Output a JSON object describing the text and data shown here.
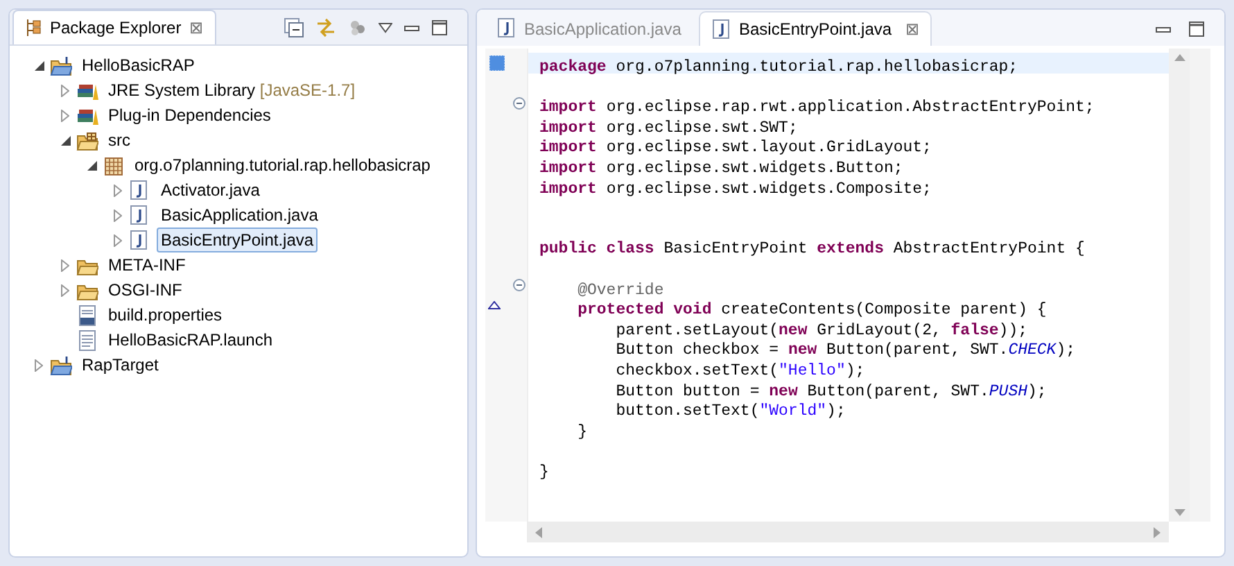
{
  "explorer": {
    "tab": {
      "label": "Package Explorer",
      "selected": true,
      "close": "⊠"
    },
    "tree": [
      {
        "label": "HelloBasicRAP",
        "kind": "project",
        "expanded": true,
        "selected": false,
        "children": [
          {
            "label": "JRE System Library",
            "suffix": "[JavaSE-1.7]",
            "kind": "library",
            "expanded": false,
            "selected": false
          },
          {
            "label": "Plug-in Dependencies",
            "kind": "library",
            "expanded": false,
            "selected": false
          },
          {
            "label": "src",
            "kind": "source-folder",
            "expanded": true,
            "selected": false,
            "children": [
              {
                "label": "org.o7planning.tutorial.rap.hellobasicrap",
                "kind": "package",
                "expanded": true,
                "selected": false,
                "children": [
                  {
                    "label": "Activator.java",
                    "kind": "java-file",
                    "expanded": false,
                    "selected": false
                  },
                  {
                    "label": "BasicApplication.java",
                    "kind": "java-file",
                    "expanded": false,
                    "selected": false
                  },
                  {
                    "label": "BasicEntryPoint.java",
                    "kind": "java-file",
                    "expanded": false,
                    "selected": true
                  }
                ]
              }
            ]
          },
          {
            "label": "META-INF",
            "kind": "folder",
            "expanded": false,
            "selected": false
          },
          {
            "label": "OSGI-INF",
            "kind": "folder",
            "expanded": false,
            "selected": false
          },
          {
            "label": "build.properties",
            "kind": "binary-file",
            "selected": false
          },
          {
            "label": "HelloBasicRAP.launch",
            "kind": "text-file",
            "selected": false
          }
        ]
      },
      {
        "label": "RapTarget",
        "kind": "project",
        "expanded": false,
        "selected": false
      }
    ]
  },
  "editor": {
    "tabs": [
      {
        "label": "BasicApplication.java",
        "selected": false
      },
      {
        "label": "BasicEntryPoint.java",
        "selected": true,
        "close": "⊠"
      }
    ],
    "lines": [
      {
        "current": true,
        "kind": "bookmark",
        "tokens": [
          {
            "kind": "keyword",
            "text": "package"
          },
          {
            "kind": "plain",
            "text": " org.o7planning.tutorial.rap.hellobasicrap;"
          }
        ]
      },
      {
        "current": false
      },
      {
        "current": false,
        "kind": "fold",
        "tokens": [
          {
            "kind": "keyword",
            "text": "import"
          },
          {
            "kind": "plain",
            "text": " org.eclipse.rap.rwt.application.AbstractEntryPoint;"
          }
        ]
      },
      {
        "current": false,
        "tokens": [
          {
            "kind": "keyword",
            "text": "import"
          },
          {
            "kind": "plain",
            "text": " org.eclipse.swt.SWT;"
          }
        ]
      },
      {
        "current": false,
        "tokens": [
          {
            "kind": "keyword",
            "text": "import"
          },
          {
            "kind": "plain",
            "text": " org.eclipse.swt.layout.GridLayout;"
          }
        ]
      },
      {
        "current": false,
        "tokens": [
          {
            "kind": "keyword",
            "text": "import"
          },
          {
            "kind": "plain",
            "text": " org.eclipse.swt.widgets.Button;"
          }
        ]
      },
      {
        "current": false,
        "tokens": [
          {
            "kind": "keyword",
            "text": "import"
          },
          {
            "kind": "plain",
            "text": " org.eclipse.swt.widgets.Composite;"
          }
        ]
      },
      {
        "current": false
      },
      {
        "current": false
      },
      {
        "current": false,
        "tokens": [
          {
            "kind": "keyword",
            "text": "public class"
          },
          {
            "kind": "plain",
            "text": " BasicEntryPoint "
          },
          {
            "kind": "keyword",
            "text": "extends"
          },
          {
            "kind": "plain",
            "text": " AbstractEntryPoint {"
          }
        ]
      },
      {
        "current": false
      },
      {
        "current": false,
        "kind": "fold",
        "tokens": [
          {
            "kind": "annotation",
            "text": "    @Override"
          }
        ]
      },
      {
        "current": false,
        "kind": "override",
        "tokens": [
          {
            "kind": "keyword",
            "text": "    protected void"
          },
          {
            "kind": "plain",
            "text": " createContents(Composite parent) {"
          }
        ]
      },
      {
        "current": false,
        "tokens": [
          {
            "kind": "plain",
            "text": "        parent.setLayout("
          },
          {
            "kind": "keyword",
            "text": "new"
          },
          {
            "kind": "plain",
            "text": " GridLayout(2, "
          },
          {
            "kind": "keyword",
            "text": "false"
          },
          {
            "kind": "plain",
            "text": "));"
          }
        ]
      },
      {
        "current": false,
        "tokens": [
          {
            "kind": "plain",
            "text": "        Button checkbox = "
          },
          {
            "kind": "keyword",
            "text": "new"
          },
          {
            "kind": "plain",
            "text": " Button(parent, SWT."
          },
          {
            "kind": "constant",
            "text": "CHECK"
          },
          {
            "kind": "plain",
            "text": ");"
          }
        ]
      },
      {
        "current": false,
        "tokens": [
          {
            "kind": "plain",
            "text": "        checkbox.setText("
          },
          {
            "kind": "string",
            "text": "\"Hello\""
          },
          {
            "kind": "plain",
            "text": ");"
          }
        ]
      },
      {
        "current": false,
        "tokens": [
          {
            "kind": "plain",
            "text": "        Button button = "
          },
          {
            "kind": "keyword",
            "text": "new"
          },
          {
            "kind": "plain",
            "text": " Button(parent, SWT."
          },
          {
            "kind": "constant",
            "text": "PUSH"
          },
          {
            "kind": "plain",
            "text": ");"
          }
        ]
      },
      {
        "current": false,
        "tokens": [
          {
            "kind": "plain",
            "text": "        button.setText("
          },
          {
            "kind": "string",
            "text": "\"World\""
          },
          {
            "kind": "plain",
            "text": ");"
          }
        ]
      },
      {
        "current": false,
        "tokens": [
          {
            "kind": "plain",
            "text": "    }"
          }
        ]
      },
      {
        "current": false
      },
      {
        "current": false,
        "tokens": [
          {
            "kind": "plain",
            "text": "}"
          }
        ]
      }
    ]
  }
}
